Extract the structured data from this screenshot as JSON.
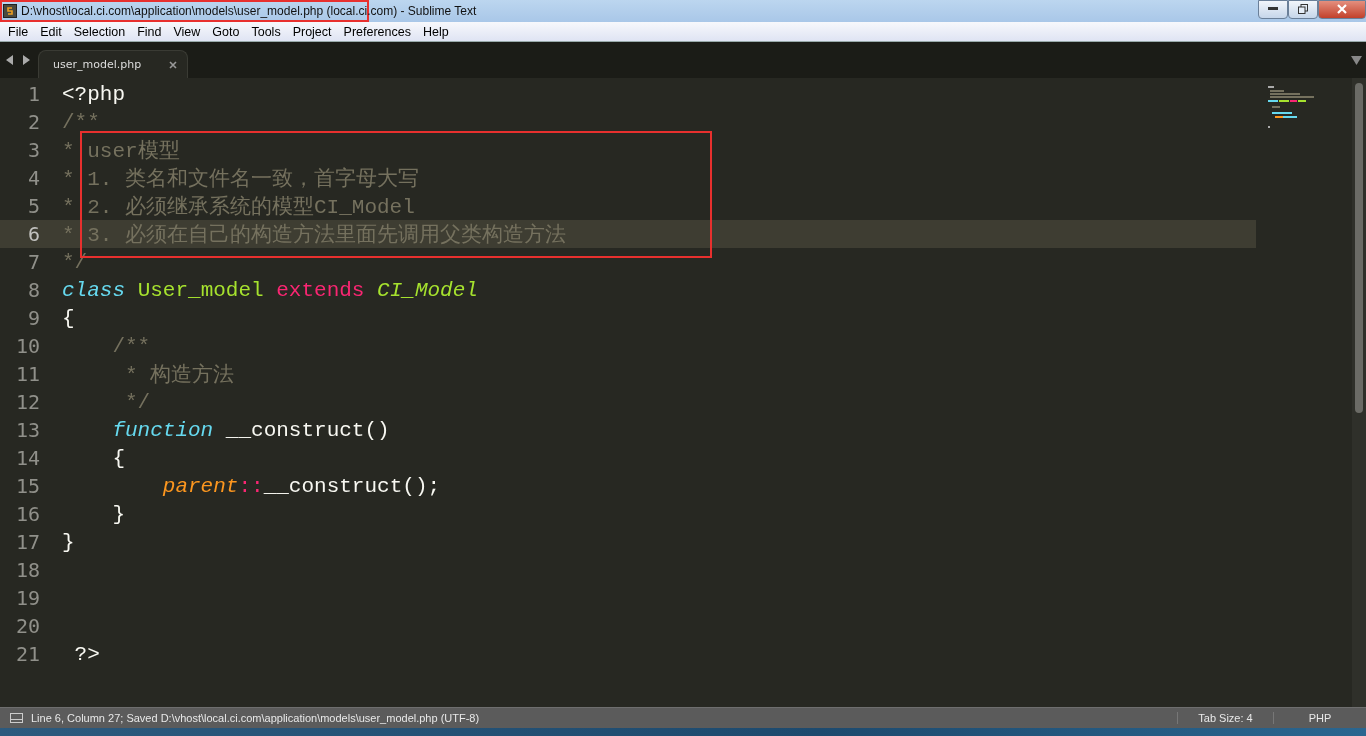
{
  "window": {
    "title": "D:\\vhost\\local.ci.com\\application\\models\\user_model.php (local.ci.com) - Sublime Text"
  },
  "menu": [
    "File",
    "Edit",
    "Selection",
    "Find",
    "View",
    "Goto",
    "Tools",
    "Project",
    "Preferences",
    "Help"
  ],
  "tabs": [
    {
      "label": "user_model.php",
      "selected": true
    }
  ],
  "lines": [
    {
      "number": "1",
      "current": false,
      "tokens": [
        {
          "kind": "plain",
          "text": "<?php"
        }
      ]
    },
    {
      "number": "2",
      "current": false,
      "tokens": [
        {
          "kind": "comment",
          "text": "/**"
        }
      ]
    },
    {
      "number": "3",
      "current": false,
      "tokens": [
        {
          "kind": "comment",
          "text": "* user模型"
        }
      ]
    },
    {
      "number": "4",
      "current": false,
      "tokens": [
        {
          "kind": "comment",
          "text": "* 1. 类名和文件名一致，首字母大写"
        }
      ]
    },
    {
      "number": "5",
      "current": false,
      "tokens": [
        {
          "kind": "comment",
          "text": "* 2. 必须继承系统的模型CI_Model"
        }
      ]
    },
    {
      "number": "6",
      "current": true,
      "tokens": [
        {
          "kind": "comment",
          "text": "* 3. 必须在自己的构造方法里面先调用父类构造方法"
        }
      ]
    },
    {
      "number": "7",
      "current": false,
      "tokens": [
        {
          "kind": "comment",
          "text": "*/"
        }
      ]
    },
    {
      "number": "8",
      "current": false,
      "tokens": [
        {
          "kind": "storage",
          "text": "class "
        },
        {
          "kind": "entity",
          "text": "User_model "
        },
        {
          "kind": "keyword",
          "text": "extends "
        },
        {
          "kind": "inherited",
          "text": "CI_Model"
        }
      ]
    },
    {
      "number": "9",
      "current": false,
      "tokens": [
        {
          "kind": "plain",
          "text": "{"
        }
      ]
    },
    {
      "number": "10",
      "current": false,
      "tokens": [
        {
          "kind": "comment",
          "text": "    /**"
        }
      ]
    },
    {
      "number": "11",
      "current": false,
      "tokens": [
        {
          "kind": "comment",
          "text": "     * 构造方法"
        }
      ]
    },
    {
      "number": "12",
      "current": false,
      "tokens": [
        {
          "kind": "comment",
          "text": "     */"
        }
      ]
    },
    {
      "number": "13",
      "current": false,
      "tokens": [
        {
          "kind": "storage",
          "text": "    function"
        },
        {
          "kind": "plain",
          "text": " __construct()"
        }
      ]
    },
    {
      "number": "14",
      "current": false,
      "tokens": [
        {
          "kind": "plain",
          "text": "    {"
        }
      ]
    },
    {
      "number": "15",
      "current": false,
      "tokens": [
        {
          "kind": "variable",
          "text": "        parent"
        },
        {
          "kind": "keyword",
          "text": "::"
        },
        {
          "kind": "plain",
          "text": "__construct();"
        }
      ]
    },
    {
      "number": "16",
      "current": false,
      "tokens": [
        {
          "kind": "plain",
          "text": "    }"
        }
      ]
    },
    {
      "number": "17",
      "current": false,
      "tokens": [
        {
          "kind": "plain",
          "text": "}"
        }
      ]
    },
    {
      "number": "18",
      "current": false
    },
    {
      "number": "19",
      "current": false
    },
    {
      "number": "20",
      "current": false
    },
    {
      "number": "21",
      "current": false,
      "tokens": [
        {
          "kind": "plain",
          "text": " ?>"
        }
      ]
    }
  ],
  "status_bar": {
    "message": "Line 6, Column 27; Saved D:\\vhost\\local.ci.com\\application\\models\\user_model.php (UTF-8)",
    "tab_size": "Tab Size: 4",
    "syntax": "PHP"
  }
}
